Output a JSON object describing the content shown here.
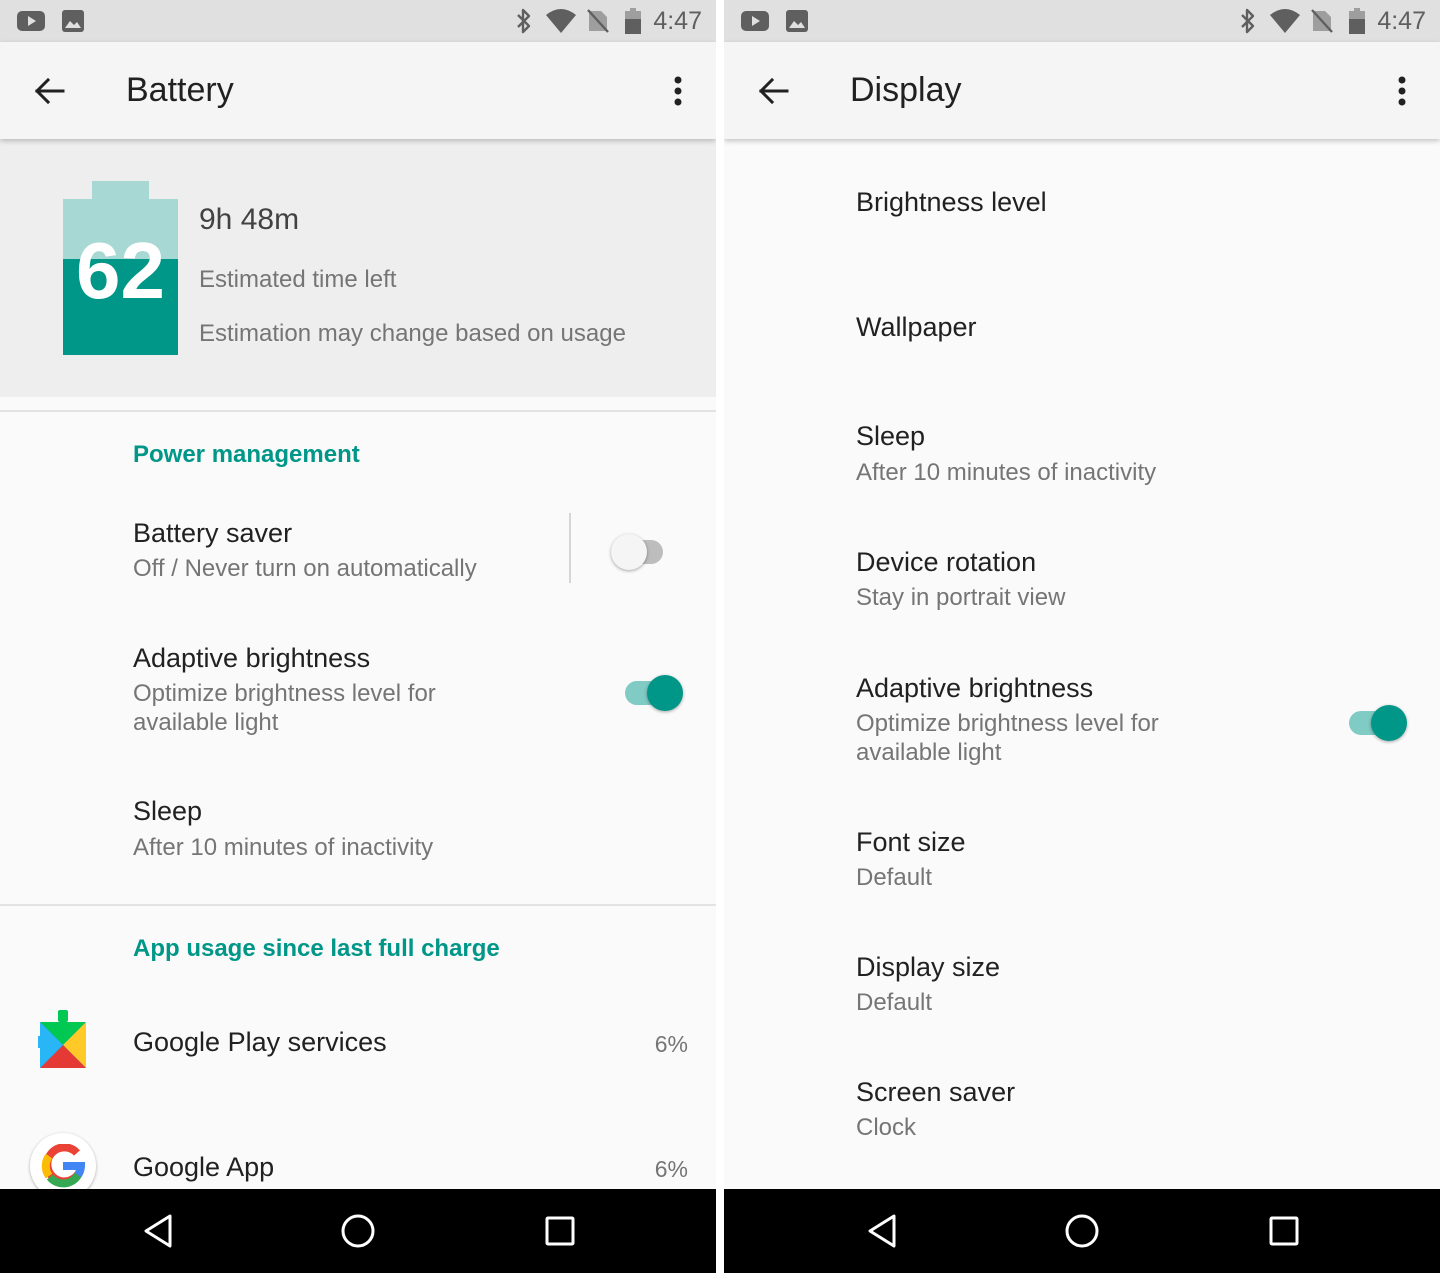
{
  "colors": {
    "accent": "#009688",
    "accent_light": "#80cbc4",
    "battery_light": "#a8d8d4"
  },
  "left": {
    "status_bar": {
      "time": "4:47",
      "icons": [
        "youtube-icon",
        "gallery-icon",
        "bluetooth-icon",
        "wifi-icon",
        "no-sim-icon",
        "battery-icon"
      ]
    },
    "app_bar": {
      "title": "Battery"
    },
    "battery_header": {
      "level": "62",
      "time_left": "9h 48m",
      "label": "Estimated time left",
      "note": "Estimation may change based on usage"
    },
    "power_management": {
      "header": "Power management",
      "items": [
        {
          "title": "Battery saver",
          "subtitle": "Off / Never turn on automatically",
          "switch": "off"
        },
        {
          "title": "Adaptive brightness",
          "subtitle": "Optimize brightness level for available light",
          "switch": "on"
        },
        {
          "title": "Sleep",
          "subtitle": "After 10 minutes of inactivity"
        }
      ]
    },
    "app_usage": {
      "header": "App usage since last full charge",
      "apps": [
        {
          "name": "Google Play services",
          "percent": "6%",
          "icon": "google-play-services-icon"
        },
        {
          "name": "Google App",
          "percent": "6%",
          "icon": "google-app-icon"
        }
      ]
    }
  },
  "right": {
    "status_bar": {
      "time": "4:47"
    },
    "app_bar": {
      "title": "Display"
    },
    "items": [
      {
        "title": "Brightness level"
      },
      {
        "title": "Wallpaper"
      },
      {
        "title": "Sleep",
        "subtitle": "After 10 minutes of inactivity"
      },
      {
        "title": "Device rotation",
        "subtitle": "Stay in portrait view"
      },
      {
        "title": "Adaptive brightness",
        "subtitle": "Optimize brightness level for available light",
        "switch": "on"
      },
      {
        "title": "Font size",
        "subtitle": "Default"
      },
      {
        "title": "Display size",
        "subtitle": "Default"
      },
      {
        "title": "Screen saver",
        "subtitle": "Clock"
      }
    ]
  }
}
